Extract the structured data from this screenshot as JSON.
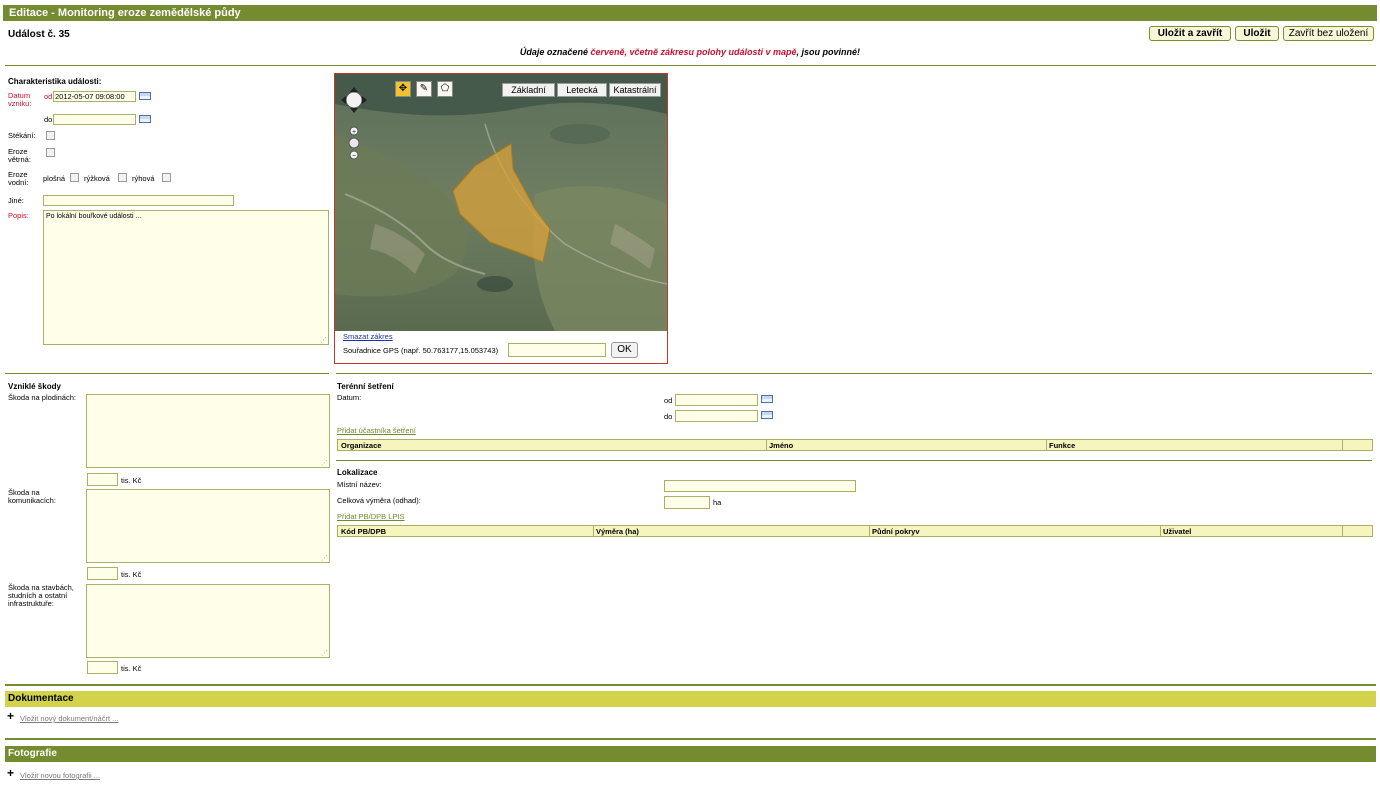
{
  "header": {
    "title": "Editace - Monitoring eroze zemědělské půdy"
  },
  "event": {
    "title": "Událost č. 35"
  },
  "actions": {
    "save_close": "Uložit a zavřít",
    "save": "Uložit",
    "close_nosave": "Zavřít bez uložení"
  },
  "notice": {
    "prefix": "Údaje označené ",
    "red": "červeně, včetně zákresu polohy události v mapě",
    "suffix": ", jsou povinné!"
  },
  "characteristics": {
    "heading": "Charakteristika události:",
    "date_label": "Datum vzniku:",
    "from_label": "od",
    "from_value": "2012-05-07 09:08:00",
    "to_label": "do",
    "to_value": "",
    "runoff_label": "Stékání:",
    "wind_label": "Eroze větrná:",
    "water_label": "Eroze vodní:",
    "water_options": [
      "plošná",
      "rýžková",
      "rýhová"
    ],
    "other_label": "Jiné:",
    "other_value": "",
    "desc_label": "Popis:",
    "desc_value": "Po lokální bouřkové události ..."
  },
  "map": {
    "tabs": [
      "Základní",
      "Letecká",
      "Katastrální"
    ],
    "tools": [
      "pointer-icon",
      "pencil-icon",
      "polygon-icon"
    ],
    "clear_link": "Smazat zákres",
    "gps_label": "Souřadnice GPS (např. 50.763177,15.053743)",
    "gps_value": "",
    "gps_ok": "OK",
    "colors": {
      "polygon_fill": "#d9a23a",
      "polygon_stroke": "#b07c1a",
      "frame": "#c0392b"
    }
  },
  "damages": {
    "heading": "Vzniklé škody",
    "items": [
      {
        "label": "Škoda na plodinách:",
        "value": "",
        "amount": "",
        "unit": "tis. Kč"
      },
      {
        "label": "Škoda na komunikacích:",
        "value": "",
        "amount": "",
        "unit": "tis. Kč"
      },
      {
        "label": "Škoda na stavbách, studních a ostatní infrastruktuře:",
        "value": "",
        "amount": "",
        "unit": "tis. Kč"
      }
    ]
  },
  "field_survey": {
    "heading": "Terénní šetření",
    "date_label": "Datum:",
    "from_label": "od",
    "from_value": "",
    "to_label": "do",
    "to_value": "",
    "add_link": "Přidat účastníka šetření",
    "columns": [
      "Organizace",
      "Jméno",
      "Funkce"
    ]
  },
  "location": {
    "heading": "Lokalizace",
    "place_label": "Místní název:",
    "place_value": "",
    "area_label": "Celková výměra (odhad):",
    "area_value": "",
    "area_unit": "ha",
    "add_link": "Přidat PB/DPB LPIS",
    "columns": [
      "Kód PB/DPB",
      "Výměra (ha)",
      "Půdní pokryv",
      "Uživatel"
    ]
  },
  "documentation": {
    "heading": "Dokumentace",
    "add_link": "Vložit nový dokument/náčrt ..."
  },
  "photos": {
    "heading": "Fotografie",
    "add_link": "Vložit novou fotografii ..."
  },
  "theme": {
    "accent": "#748b2f",
    "band_light": "#d3d34b",
    "required": "#c8102e",
    "input_bg": "#fffee8"
  }
}
